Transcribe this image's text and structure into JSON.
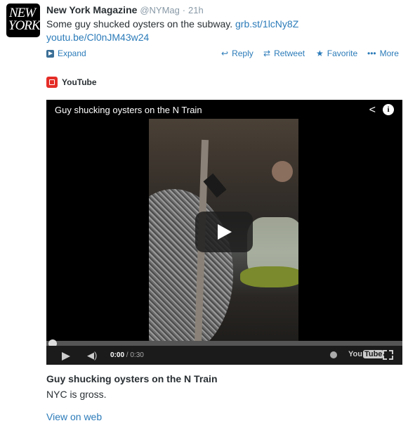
{
  "tweet": {
    "author_name": "New York Magazine",
    "handle": "@NYMag",
    "separator": "·",
    "time": "21h",
    "avatar_text_line1": "NEW",
    "avatar_text_line2": "YORK",
    "text_before": "Some guy shucked oysters on the subway. ",
    "link1": "grb.st/1lcNy8Z",
    "link2": "youtu.be/Cl0nJM43w24"
  },
  "actions": {
    "expand": "Expand",
    "reply": "Reply",
    "retweet": "Retweet",
    "favorite": "Favorite",
    "more": "More"
  },
  "card": {
    "source": "YouTube",
    "video_title": "Guy shucking oysters on the N Train",
    "current_time": "0:00",
    "duration": "/ 0:30",
    "yt_word": "You",
    "yt_word_box": "Tube",
    "title": "Guy shucking oysters on the N Train",
    "description": "NYC is gross.",
    "view_on_web": "View on web"
  },
  "colors": {
    "link": "#2b7bb9",
    "youtube_red": "#e52d27",
    "muted": "#8899a6"
  }
}
